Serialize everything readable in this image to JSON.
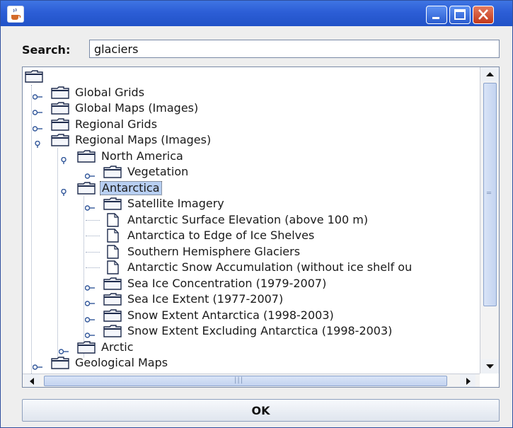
{
  "window": {
    "title": ""
  },
  "search": {
    "label": "Search:",
    "value": "glaciers"
  },
  "tree": {
    "nodes": [
      {
        "label": "",
        "icon": "folder-icon",
        "level": 0,
        "expandable": false
      },
      {
        "label": "Global Grids",
        "icon": "folder-icon",
        "level": 1,
        "expandable": true,
        "expanded": false
      },
      {
        "label": "Global Maps (Images)",
        "icon": "folder-icon",
        "level": 1,
        "expandable": true,
        "expanded": false
      },
      {
        "label": "Regional Grids",
        "icon": "folder-icon",
        "level": 1,
        "expandable": true,
        "expanded": false
      },
      {
        "label": "Regional Maps (Images)",
        "icon": "folder-icon",
        "level": 1,
        "expandable": true,
        "expanded": true
      },
      {
        "label": "North America",
        "icon": "folder-icon",
        "level": 2,
        "expandable": true,
        "expanded": true
      },
      {
        "label": "Vegetation",
        "icon": "folder-icon",
        "level": 3,
        "expandable": true,
        "expanded": false
      },
      {
        "label": "Antarctica",
        "icon": "folder-icon",
        "level": 2,
        "expandable": true,
        "expanded": true,
        "selected": true
      },
      {
        "label": "Satellite Imagery",
        "icon": "folder-icon",
        "level": 3,
        "expandable": true,
        "expanded": false
      },
      {
        "label": "Antarctic Surface Elevation (above 100 m)",
        "icon": "document-icon",
        "level": 3,
        "expandable": false
      },
      {
        "label": "Antarctica to  Edge of Ice Shelves",
        "icon": "document-icon",
        "level": 3,
        "expandable": false
      },
      {
        "label": "Southern Hemisphere Glaciers",
        "icon": "document-icon",
        "level": 3,
        "expandable": false
      },
      {
        "label": "Antarctic Snow Accumulation (without ice shelf ou",
        "icon": "document-icon",
        "level": 3,
        "expandable": false
      },
      {
        "label": "Sea Ice Concentration (1979-2007)",
        "icon": "folder-icon",
        "level": 3,
        "expandable": true,
        "expanded": false
      },
      {
        "label": "Sea Ice Extent (1977-2007)",
        "icon": "folder-icon",
        "level": 3,
        "expandable": true,
        "expanded": false
      },
      {
        "label": "Snow Extent Antarctica (1998-2003)",
        "icon": "folder-icon",
        "level": 3,
        "expandable": true,
        "expanded": false
      },
      {
        "label": "Snow Extent Excluding Antarctica (1998-2003)",
        "icon": "folder-icon",
        "level": 3,
        "expandable": true,
        "expanded": false
      },
      {
        "label": "Arctic",
        "icon": "folder-icon",
        "level": 2,
        "expandable": true,
        "expanded": false
      },
      {
        "label": "Geological Maps",
        "icon": "folder-icon",
        "level": 1,
        "expandable": true,
        "expanded": false
      }
    ]
  },
  "buttons": {
    "ok": "OK"
  },
  "colors": {
    "titlebar": "#2c5ed6",
    "selection": "#b8cff2",
    "close": "#c2381b"
  }
}
